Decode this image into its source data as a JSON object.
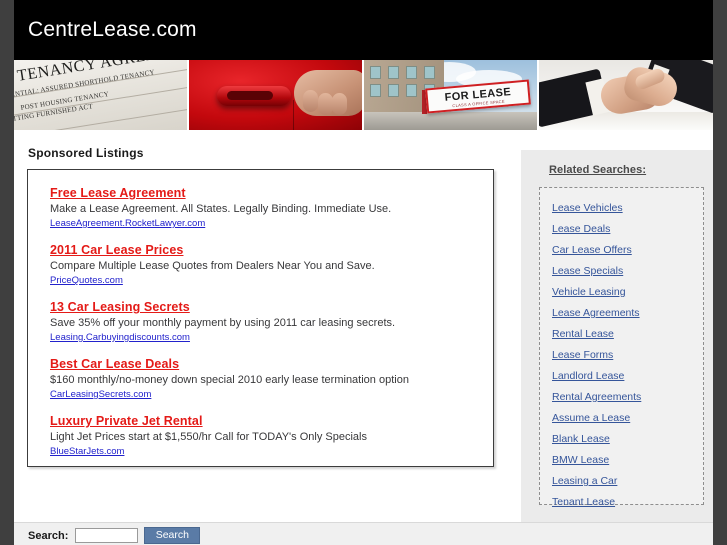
{
  "header": {
    "site_title": "CentreLease.com",
    "background_color": "#000000",
    "text_color": "#ffffff"
  },
  "banners": [
    {
      "name": "tenancy-agreement-document",
      "title_text": "TENANCY AGREEMENT",
      "sub_line_1": "ENTIAL: ASSURED SHORTHOLD TENANCY",
      "sub_line_2": "POST HOUSING TENANCY",
      "sub_line_3": "TTING FURNISHED ACT"
    },
    {
      "name": "red-car-door-handle"
    },
    {
      "name": "for-lease-building-sign",
      "sign_text": "FOR LEASE",
      "sign_subtext": "CLASS A OFFICE SPACE"
    },
    {
      "name": "business-handshake"
    }
  ],
  "main": {
    "section_title": "Sponsored Listings",
    "listings": [
      {
        "title": "Free Lease Agreement",
        "description": "Make a Lease Agreement. All States. Legally Binding. Immediate Use.",
        "url": "LeaseAgreement.RocketLawyer.com"
      },
      {
        "title": "2011 Car Lease Prices",
        "description": "Compare Multiple Lease Quotes from Dealers Near You and Save.",
        "url": "PriceQuotes.com"
      },
      {
        "title": "13 Car Leasing Secrets",
        "description": "Save 35% off your monthly payment by using 2011 car leasing secrets.",
        "url": "Leasing.Carbuyingdiscounts.com"
      },
      {
        "title": "Best Car Lease Deals",
        "description": "$160 monthly/no-money down special 2010 early lease termination option",
        "url": "CarLeasingSecrets.com"
      },
      {
        "title": "Luxury Private Jet Rental",
        "description": "Light Jet Prices start at $1,550/hr Call for TODAY's Only Specials",
        "url": "BlueStarJets.com"
      }
    ],
    "colors": {
      "listing_title": "#e41a17",
      "listing_description": "#38383a",
      "listing_url": "#2222cc"
    }
  },
  "sidebar": {
    "heading": "Related Searches:",
    "links": [
      "Lease Vehicles",
      "Lease Deals",
      "Car Lease Offers",
      "Lease Specials",
      "Vehicle Leasing",
      "Lease Agreements",
      "Rental Lease",
      "Lease Forms",
      "Landlord Lease",
      "Rental Agreements",
      "Assume a Lease",
      "Blank Lease",
      "BMW Lease",
      "Leasing a Car",
      "Tenant Lease"
    ],
    "link_color": "#35559a",
    "background_color": "#ebebeb"
  },
  "footer": {
    "search_label": "Search:",
    "search_value": "",
    "search_placeholder": "",
    "search_button_label": "Search",
    "search_button_color": "#5a7ba6"
  }
}
